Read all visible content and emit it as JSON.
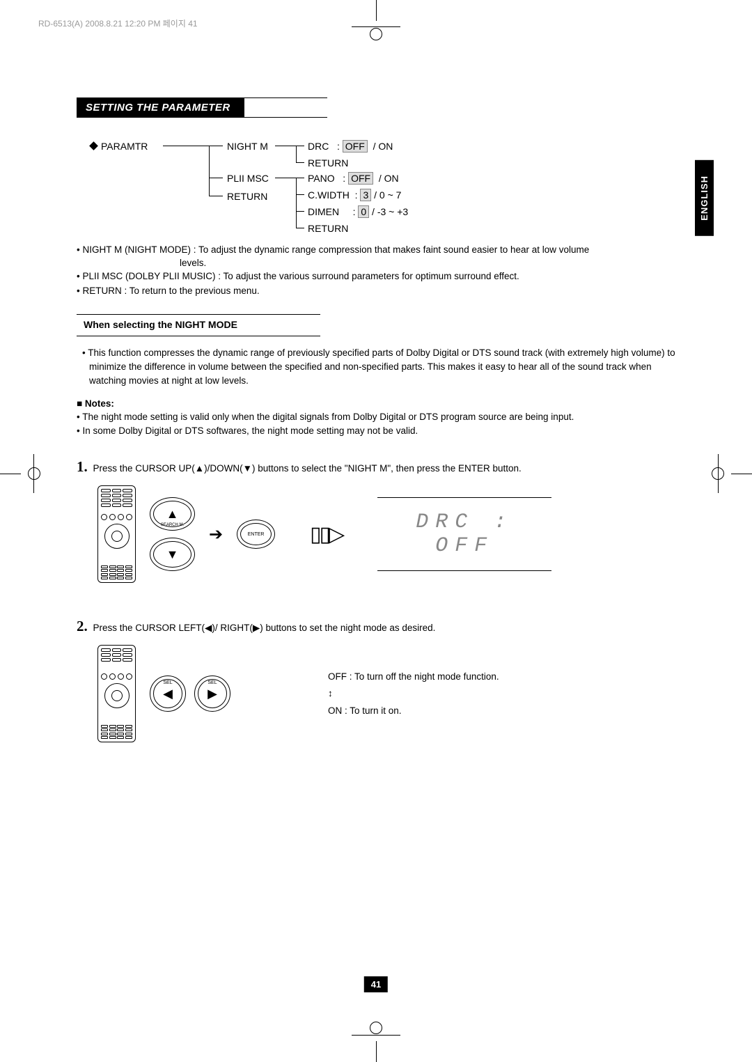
{
  "file_header": "RD-6513(A)  2008.8.21  12:20 PM  페이지 41",
  "language_tab": "ENGLISH",
  "section_title": "SETTING THE PARAMETER",
  "tree": {
    "root": "PARAMTR",
    "branch1": {
      "label": "NIGHT  M",
      "items": [
        {
          "name": "DRC",
          "value": "OFF",
          "options": "/  ON"
        },
        {
          "name": "RETURN"
        }
      ]
    },
    "branch2": {
      "label": "PLII  MSC",
      "items": [
        {
          "name": "PANO",
          "value": "OFF",
          "options": "/  ON"
        },
        {
          "name": "C.WIDTH",
          "value": "3",
          "options": "/ 0 ~ 7"
        },
        {
          "name": "DIMEN",
          "value": "0",
          "options": "/ -3 ~ +3"
        },
        {
          "name": "RETURN"
        }
      ]
    },
    "branch3": {
      "label": "RETURN"
    }
  },
  "desc": [
    "NIGHT M (NIGHT MODE) : To adjust the dynamic range compression that makes faint sound easier to hear at low volume",
    "levels.",
    "PLII MSC (DOLBY PLII MUSIC) : To adjust the various surround parameters for optimum surround effect.",
    "RETURN : To return to the previous menu."
  ],
  "subheading": "When selecting the NIGHT MODE",
  "night_para": "This function compresses the dynamic range of previously specified parts of Dolby Digital or DTS sound track (with extremely high volume) to minimize the difference in volume between the specified and non-specified parts. This makes it easy to hear all of the sound track when watching movies at night at low levels.",
  "notes_label": "Notes:",
  "notes": [
    "The night mode setting is valid only when the digital signals from Dolby Digital or DTS program source are being input.",
    "In some Dolby Digital or DTS softwares, the night mode setting may not be valid."
  ],
  "step1": {
    "num": "1.",
    "text": " Press the CURSOR UP(▲)/DOWN(▼) buttons to select the \"NIGHT M\", then press the ENTER button.",
    "enter_label": "ENTER",
    "search_label": "SEARCH M.",
    "display": "DRC : OFF"
  },
  "step2": {
    "num": "2.",
    "text": " Press the CURSOR LEFT(◀)/ RIGHT(▶) buttons to set the night mode as desired.",
    "sel_label": "SEL",
    "off_text": "OFF : To turn off the night mode function.",
    "on_text": "ON : To turn it on."
  },
  "page_number": "41"
}
